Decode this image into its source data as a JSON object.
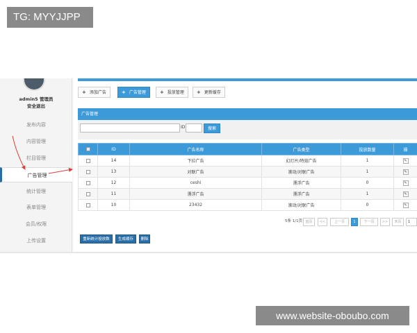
{
  "overlay": {
    "tag": "TG: MYYJJPP",
    "watermark": "www.website-oboubo.com"
  },
  "sidebar": {
    "user_name": "admin5 管理员",
    "user_action": "安全退出",
    "items": [
      {
        "label": "发布内容"
      },
      {
        "label": "内容管理"
      },
      {
        "label": "栏目管理"
      },
      {
        "label": "广告管理"
      },
      {
        "label": "统计管理"
      },
      {
        "label": "表单管理"
      },
      {
        "label": "会员/权限"
      },
      {
        "label": "上传设置"
      }
    ],
    "active_index": 3
  },
  "toolbar": {
    "buttons": [
      {
        "label": "添加广告"
      },
      {
        "label": "广告管理"
      },
      {
        "label": "投放管理"
      },
      {
        "label": "更新缓存"
      }
    ],
    "active_index": 1
  },
  "section": {
    "title": "广告管理",
    "id_label": "ID",
    "search_button": "搜索",
    "keyword_value": "",
    "id_value": ""
  },
  "table": {
    "columns": [
      "",
      "ID",
      "广告名称",
      "广告类型",
      "投放数量",
      "操"
    ],
    "rows": [
      {
        "id": "14",
        "name": "下拉广告",
        "type": "幻灯片/特效广告",
        "count": "1"
      },
      {
        "id": "13",
        "name": "对联广告",
        "type": "滚动/对联广告",
        "count": "1"
      },
      {
        "id": "12",
        "name": "ceshi",
        "type": "漂浮广告",
        "count": "0"
      },
      {
        "id": "11",
        "name": "漂浮广告",
        "type": "漂浮广告",
        "count": "1"
      },
      {
        "id": "10",
        "name": "23432",
        "type": "滚动/对联广告",
        "count": "0"
      }
    ]
  },
  "pagination": {
    "summary": "5条 1/1页",
    "first": "首页",
    "prev_arrow": "<<",
    "prev": "上一页",
    "current": "1",
    "next": "下一页",
    "next_arrow": ">>",
    "last": "末页",
    "page_input": "1"
  },
  "actions": {
    "stats": "重新统计投放数",
    "generate": "生成缓存",
    "delete": "删除"
  },
  "colors": {
    "accent": "#3d9ad9",
    "dark_button": "#2a6ea6",
    "annotation_arrow": "#e03b3b"
  }
}
